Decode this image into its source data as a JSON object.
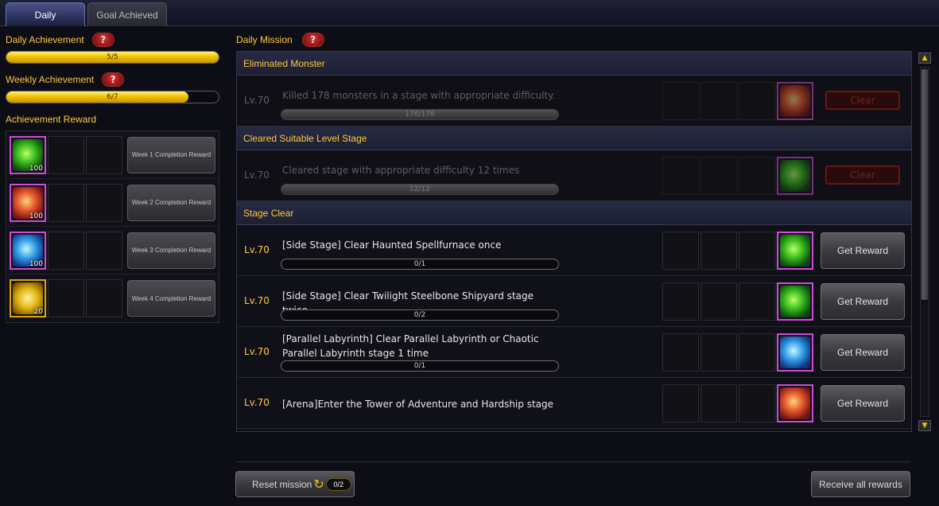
{
  "tabs": [
    {
      "label": "Daily",
      "active": true
    },
    {
      "label": "Goal Achieved",
      "active": false
    }
  ],
  "help_glyph": "?",
  "left": {
    "daily": {
      "label": "Daily Achievement",
      "progress_text": "5/5",
      "progress": 1.0
    },
    "weekly": {
      "label": "Weekly Achievement",
      "progress_text": "6/7",
      "progress": 0.857
    },
    "reward_title": "Achievement Reward",
    "rewards": [
      {
        "qty": "100",
        "orb": "green-orb",
        "button": "Week 1 Completion Reward"
      },
      {
        "qty": "100",
        "orb": "red-orb",
        "button": "Week 2 Completion Reward"
      },
      {
        "qty": "100",
        "orb": "blue-orb",
        "button": "Week 3 Completion Reward"
      },
      {
        "qty": "20",
        "orb": "gold-chest",
        "button": "Week 4 Completion Reward"
      }
    ]
  },
  "mission": {
    "title": "Daily Mission",
    "sections": [
      {
        "title": "Eliminated Monster"
      },
      {
        "title": "Cleared Suitable Level Stage"
      },
      {
        "title": "Stage Clear"
      }
    ],
    "items": [
      {
        "level": "Lv.70",
        "desc": "Killed 178 monsters in a stage with appropriate difficulty.",
        "progress_text": "178/178",
        "progress": 1.0,
        "button": "Clear",
        "state": "done",
        "orb": "red-orb"
      },
      {
        "level": "Lv.70",
        "desc": "Cleared stage with appropriate difficulty 12 times",
        "progress_text": "12/12",
        "progress": 1.0,
        "button": "Clear",
        "state": "done",
        "orb": "green-orb"
      },
      {
        "level": "Lv.70",
        "desc": "[Side Stage] Clear Haunted Spellfurnace once",
        "progress_text": "0/1",
        "progress": 0,
        "button": "Get Reward",
        "state": "active",
        "orb": "green-orb"
      },
      {
        "level": "Lv.70",
        "desc": "[Side Stage] Clear Twilight Steelbone Shipyard stage twice",
        "progress_text": "0/2",
        "progress": 0,
        "button": "Get Reward",
        "state": "active",
        "orb": "green-orb"
      },
      {
        "level": "Lv.70",
        "desc": "[Parallel Labyrinth] Clear Parallel Labyrinth or Chaotic Parallel Labyrinth stage 1 time",
        "progress_text": "0/1",
        "progress": 0,
        "button": "Get Reward",
        "state": "active",
        "orb": "blue-orb"
      },
      {
        "level": "Lv.70",
        "desc": "[Arena]Enter the Tower of Adventure and Hardship stage",
        "progress_text": "",
        "progress": 0,
        "button": "Get Reward",
        "state": "active",
        "orb": "red-orb"
      }
    ]
  },
  "bottom": {
    "reset_label": "Reset mission",
    "reset_count": "0/2",
    "receive_all_label": "Receive all rewards"
  },
  "colors": {
    "accent_gold": "#ffc93d",
    "help_red": "#c42828",
    "frame_purple": "#cf4bd6"
  }
}
